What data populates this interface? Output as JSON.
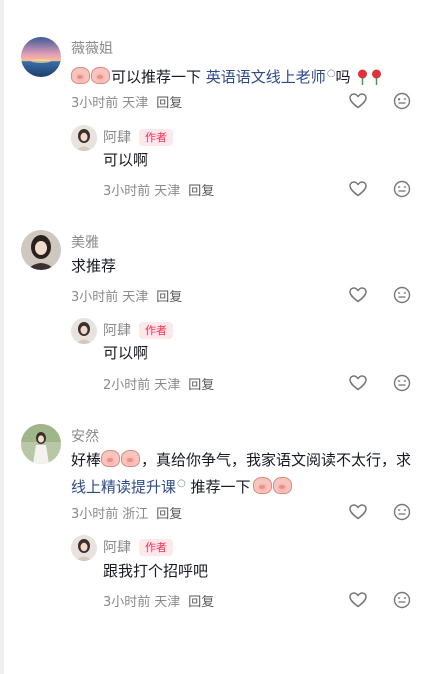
{
  "comments": [
    {
      "user": "薇薇姐",
      "text_before": "可以推荐一下",
      "link": "英语语文线上老师",
      "text_after": "吗",
      "time": "3小时前",
      "location": "天津",
      "reply_label": "回复",
      "reply": {
        "user": "阿肆",
        "author_tag": "作者",
        "text": "可以啊",
        "time": "3小时前",
        "location": "天津",
        "reply_label": "回复"
      }
    },
    {
      "user": "美雅",
      "text": "求推荐",
      "time": "3小时前",
      "location": "天津",
      "reply_label": "回复",
      "reply": {
        "user": "阿肆",
        "author_tag": "作者",
        "text": "可以啊",
        "time": "2小时前",
        "location": "天津",
        "reply_label": "回复"
      }
    },
    {
      "user": "安然",
      "line1_before": "好棒",
      "line1_after": "，真给你争气，我家语文阅读不太行，求",
      "link": "线上精读提升课",
      "line2_after": "推荐一下",
      "time": "3小时前",
      "location": "浙江",
      "reply_label": "回复",
      "reply": {
        "user": "阿肆",
        "author_tag": "作者",
        "text": "跟我打个招呼吧",
        "time": "3小时前",
        "location": "天津",
        "reply_label": "回复"
      }
    }
  ],
  "icons": {
    "like": "heart-outline-icon",
    "more": "emoji-face-icon",
    "search": "search-glyph-icon"
  },
  "colors": {
    "link": "#2d4a8a",
    "author_tag_text": "#fe2c55",
    "author_tag_bg": "#fde8ec",
    "meta": "#8a8a8a"
  }
}
